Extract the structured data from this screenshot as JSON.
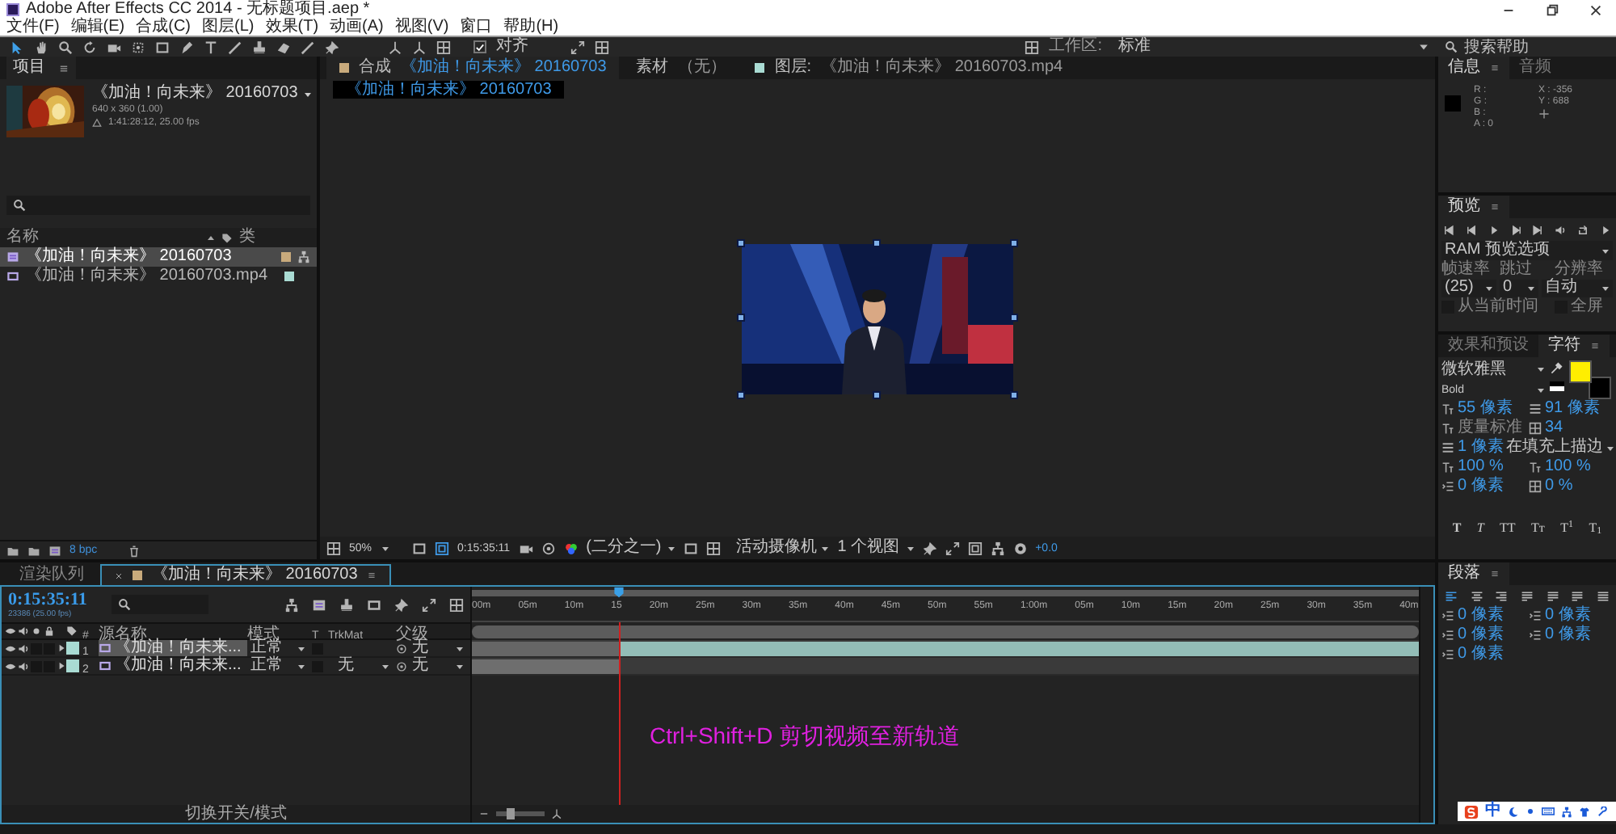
{
  "window": {
    "title": "Adobe After Effects CC 2014 - 无标题项目.aep *"
  },
  "menu": [
    "文件(F)",
    "编辑(E)",
    "合成(C)",
    "图层(L)",
    "效果(T)",
    "动画(A)",
    "视图(V)",
    "窗口",
    "帮助(H)"
  ],
  "toolbar": {
    "snap": {
      "label": "对齐",
      "checked": true
    },
    "workspace_label": "工作区:",
    "workspace": "标准",
    "search_placeholder": "搜索帮助"
  },
  "project": {
    "tab": "项目",
    "preview": {
      "title": "《加油！向未来》 20160703",
      "size": "640 x 360 (1.00)",
      "duration": "1:41:28:12, 25.00 fps"
    },
    "columns": [
      "名称",
      "类"
    ],
    "items": [
      {
        "name": "《加油！向未来》 20160703",
        "kind": "comp",
        "selected": true,
        "color": "#c8aa7c"
      },
      {
        "name": "《加油！向未来》 20160703.mp4",
        "kind": "footage",
        "selected": false,
        "color": "#a9dbd3"
      }
    ],
    "depth": "8 bpc"
  },
  "viewer": {
    "tabs": [
      {
        "label": "合成",
        "name": "《加油！向未来》 20160703",
        "kind": "comp",
        "selected": true
      },
      {
        "label": "素材",
        "name": "（无）",
        "kind": "footage",
        "selected": false
      },
      {
        "label": "图层:",
        "name": "《加油！向未来》 20160703.mp4",
        "kind": "layer",
        "selected": false
      }
    ],
    "breadcrumb": "《加油！向未来》 20160703",
    "zoom": "50%",
    "time": "0:15:35:11",
    "resolution": "(二分之一)",
    "camera": "活动摄像机",
    "views": "1 个视图",
    "exposure": "+0.0"
  },
  "info": {
    "tabs": [
      {
        "label": "信息",
        "selected": true
      },
      {
        "label": "音频",
        "selected": false
      }
    ],
    "channels": [
      "R :",
      "G :",
      "B :",
      "A : 0"
    ],
    "coords": [
      "X : -356",
      "Y : 688"
    ]
  },
  "preview": {
    "tab": "预览",
    "ram_options": "RAM 预览选项",
    "labels": [
      "帧速率",
      "跳过",
      "分辨率"
    ],
    "values": [
      "(25)",
      "0",
      "自动"
    ],
    "options": [
      {
        "label": "从当前时间",
        "checked": false
      },
      {
        "label": "全屏",
        "checked": false
      }
    ]
  },
  "character": {
    "tabs": [
      {
        "label": "效果和预设",
        "selected": false
      },
      {
        "label": "字符",
        "selected": true
      }
    ],
    "font": "微软雅黑",
    "style": "Bold",
    "swatches": [
      {
        "kind": "fill",
        "color": "#ffee00"
      },
      {
        "kind": "stroke",
        "color": "#000000"
      }
    ],
    "fields": [
      {
        "value": "55 像素",
        "kind": "number"
      },
      {
        "value": "91 像素",
        "kind": "number"
      },
      {
        "value": "度量标准",
        "kind": "preset"
      },
      {
        "value": "34",
        "kind": "number"
      },
      {
        "value": "1 像素",
        "kind": "number"
      },
      {
        "value": "在填充上描边",
        "kind": "menu"
      },
      {
        "value": "100 %",
        "kind": "number"
      },
      {
        "value": "100 %",
        "kind": "number"
      },
      {
        "value": "0 像素",
        "kind": "number"
      },
      {
        "value": "0 %",
        "kind": "number"
      }
    ],
    "styles": [
      {
        "label": "T",
        "kind": "bold"
      },
      {
        "label": "T",
        "kind": "italic"
      },
      {
        "label": "TT",
        "kind": "caps"
      },
      {
        "label": "Tᴛ",
        "kind": "smallcaps"
      },
      {
        "label": "T$^{1}$",
        "kind": "super"
      },
      {
        "label": "T$_{1}$",
        "kind": "sub"
      }
    ]
  },
  "paragraph": {
    "tab": "段落",
    "align": [
      {
        "kind": "left",
        "selected": true
      },
      {
        "kind": "center",
        "selected": false
      },
      {
        "kind": "right",
        "selected": false
      },
      {
        "kind": "justify",
        "selected": false
      },
      {
        "kind": "justify",
        "selected": false
      },
      {
        "kind": "justify",
        "selected": false
      },
      {
        "kind": "justify-all",
        "selected": false
      }
    ],
    "indents": [
      "0 像素",
      "0 像素",
      "0 像素",
      "0 像素",
      "0 像素"
    ]
  },
  "timeline": {
    "tabs": [
      {
        "label": "渲染队列",
        "selected": false
      },
      {
        "label": "《加油！向未来》 20160703",
        "selected": true
      }
    ],
    "time": "0:15:35:11",
    "frames": "23386 (25.00 fps)",
    "columns": [
      "#",
      "源名称",
      "模式",
      "T",
      "TrkMat",
      "父级"
    ],
    "ruler": [
      "00m",
      "05m",
      "10m",
      "15",
      "20m",
      "25m",
      "30m",
      "35m",
      "40m",
      "45m",
      "50m",
      "55m",
      "1:00m",
      "05m",
      "10m",
      "15m",
      "20m",
      "25m",
      "30m",
      "35m",
      "40m"
    ],
    "playhead": {
      "level": 0.155
    },
    "zoom_slider": {
      "level": 0.3
    },
    "layers": [
      {
        "number": "1",
        "name": "《加油！向未来...",
        "mode": "正常",
        "parent": "无",
        "color": "#a9dbd3",
        "selected": true,
        "kind": "tail"
      },
      {
        "number": "2",
        "name": "《加油！向未来...",
        "mode": "正常",
        "trkmat": "无",
        "parent": "无",
        "color": "#a9dbd3",
        "selected": false,
        "kind": "head"
      }
    ],
    "note": "Ctrl+Shift+D 剪切视频至新轨道",
    "footer": "切换开关/模式"
  },
  "ime": {
    "label": "中"
  }
}
